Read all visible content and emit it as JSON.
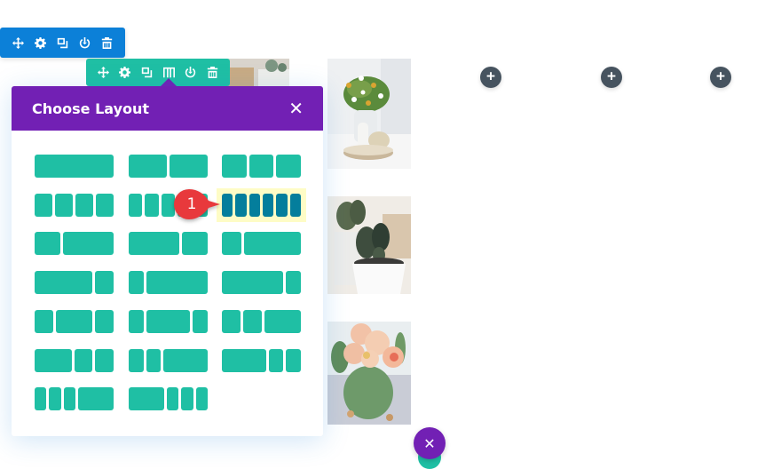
{
  "section_toolbar": {
    "icons": [
      "move-icon",
      "gear-icon",
      "duplicate-icon",
      "power-icon",
      "trash-icon"
    ],
    "color": "#0c80d8"
  },
  "row_toolbar": {
    "icons": [
      "move-icon",
      "gear-icon",
      "duplicate-icon",
      "columns-icon",
      "power-icon",
      "trash-icon"
    ],
    "color": "#1fbfa4"
  },
  "modal": {
    "title": "Choose Layout",
    "close_label": "✕",
    "header_color": "#7220b4",
    "layouts": [
      {
        "id": "1",
        "cols": [
          4
        ]
      },
      {
        "id": "1_2,1_2",
        "cols": [
          2,
          2
        ]
      },
      {
        "id": "1_3,1_3,1_3",
        "cols": [
          1,
          1,
          1
        ]
      },
      {
        "id": "1_4x4",
        "cols": [
          1,
          1,
          1,
          1
        ]
      },
      {
        "id": "1_5x5",
        "cols": [
          1,
          1,
          1,
          1,
          1
        ]
      },
      {
        "id": "1_6x6",
        "cols": [
          1,
          1,
          1,
          1,
          1,
          1
        ],
        "selected": true
      },
      {
        "id": "1_3,2_3",
        "cols": [
          1,
          2
        ]
      },
      {
        "id": "2_3,1_3",
        "cols": [
          2,
          1
        ]
      },
      {
        "id": "1_4,3_4",
        "cols": [
          1,
          3
        ]
      },
      {
        "id": "3_4,1_4",
        "cols": [
          3,
          1
        ]
      },
      {
        "id": "1_5,4_5",
        "cols": [
          1,
          4
        ]
      },
      {
        "id": "4_5,1_5",
        "cols": [
          4,
          1
        ]
      },
      {
        "id": "1_4,1_2,1_4",
        "cols": [
          1,
          2,
          1
        ]
      },
      {
        "id": "1_5,3_5,1_5",
        "cols": [
          1,
          3,
          1
        ]
      },
      {
        "id": "1_4,1_4,1_2",
        "cols": [
          1,
          1,
          2
        ]
      },
      {
        "id": "1_2,1_4,1_4",
        "cols": [
          2,
          1,
          1
        ]
      },
      {
        "id": "1_5,1_5,3_5",
        "cols": [
          1,
          1,
          3
        ]
      },
      {
        "id": "3_5,1_5,1_5",
        "cols": [
          3,
          1,
          1
        ]
      },
      {
        "id": "1_6,1_6,1_6,1_2",
        "cols": [
          1,
          1,
          1,
          3
        ]
      },
      {
        "id": "1_2,1_6,1_6,1_6",
        "cols": [
          3,
          1,
          1,
          1
        ]
      }
    ]
  },
  "callout": {
    "number": "1",
    "color": "#e8393c"
  },
  "photos": [
    {
      "subject": "daisies-in-vase-with-pumpkin"
    },
    {
      "subject": "cactus-in-white-pot"
    },
    {
      "subject": "peony-bouquet"
    },
    {
      "subject": "succulent-partial"
    }
  ],
  "add_buttons": [
    {
      "label": "+"
    },
    {
      "label": "+"
    },
    {
      "label": "+"
    }
  ],
  "close_fab": {
    "label": "✕",
    "color": "#7220b4"
  }
}
